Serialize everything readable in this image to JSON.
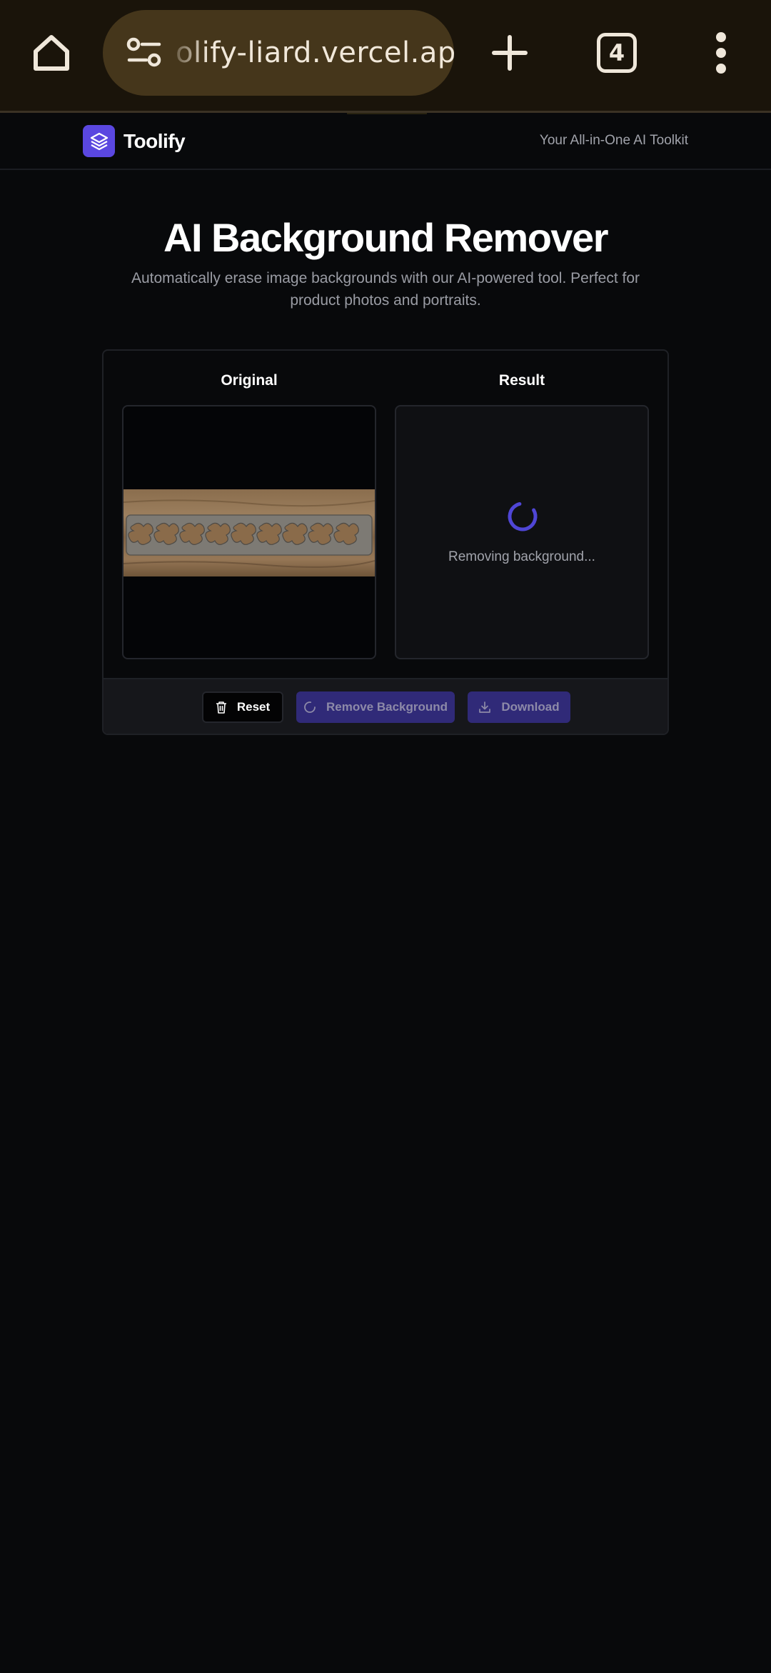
{
  "browser": {
    "url": "olify-liard.vercel.app",
    "tab_count": "4"
  },
  "site": {
    "brand": "Toolify",
    "tagline": "Your All-in-One AI Toolkit"
  },
  "hero": {
    "title": "AI Background Remover",
    "subtitle": "Automatically erase image backgrounds with our AI-powered tool. Perfect for product photos and portraits."
  },
  "tool": {
    "original_label": "Original",
    "result_label": "Result",
    "status": "Removing background...",
    "buttons": {
      "reset": "Reset",
      "remove": "Remove Background",
      "download": "Download"
    }
  },
  "icons": {
    "home": "home-icon",
    "site_settings": "tune-icon",
    "new_tab": "plus-icon",
    "menu": "more-vert-icon",
    "logo": "layers-icon",
    "reset": "trash-icon",
    "remove": "spinner-icon",
    "download": "download-icon"
  },
  "colors": {
    "accent": "#5a47e0",
    "page_bg": "#08090b",
    "browser_bar": "#1a140a"
  }
}
